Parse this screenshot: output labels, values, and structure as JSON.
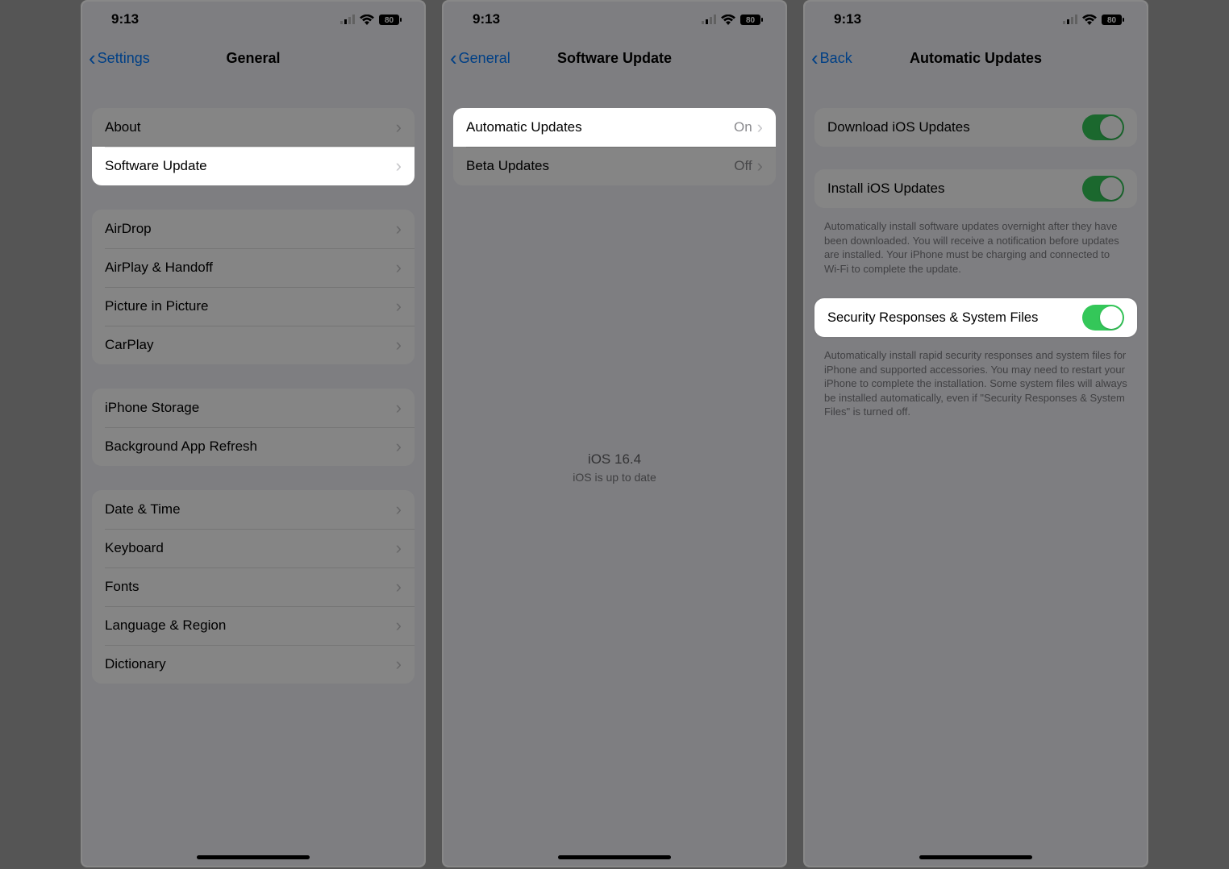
{
  "status": {
    "time": "9:13",
    "battery": "80"
  },
  "panel1": {
    "back": "Settings",
    "title": "General",
    "group1": [
      "About",
      "Software Update"
    ],
    "group2": [
      "AirDrop",
      "AirPlay & Handoff",
      "Picture in Picture",
      "CarPlay"
    ],
    "group3": [
      "iPhone Storage",
      "Background App Refresh"
    ],
    "group4": [
      "Date & Time",
      "Keyboard",
      "Fonts",
      "Language & Region",
      "Dictionary"
    ]
  },
  "panel2": {
    "back": "General",
    "title": "Software Update",
    "rows": {
      "auto": {
        "label": "Automatic Updates",
        "value": "On"
      },
      "beta": {
        "label": "Beta Updates",
        "value": "Off"
      }
    },
    "ios_version": "iOS 16.4",
    "ios_status": "iOS is up to date"
  },
  "panel3": {
    "back": "Back",
    "title": "Automatic Updates",
    "download_label": "Download iOS Updates",
    "install_label": "Install iOS Updates",
    "install_footer": "Automatically install software updates overnight after they have been downloaded. You will receive a notification before updates are installed. Your iPhone must be charging and connected to Wi-Fi to complete the update.",
    "security_label": "Security Responses & System Files",
    "security_footer": "Automatically install rapid security responses and system files for iPhone and supported accessories. You may need to restart your iPhone to complete the installation. Some system files will always be installed automatically, even if \"Security Responses & System Files\" is turned off."
  }
}
